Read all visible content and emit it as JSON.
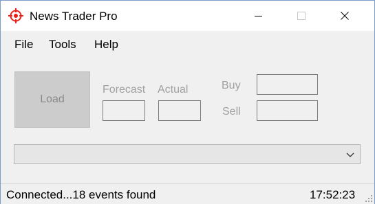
{
  "window": {
    "title": "News Trader Pro",
    "icons": {
      "app": "crosshair-target-icon",
      "minimize": "minimize-icon",
      "maximize": "maximize-icon",
      "close": "close-icon"
    },
    "accent_color": "#e8231c"
  },
  "menu": {
    "items": [
      {
        "label": "File"
      },
      {
        "label": "Tools"
      },
      {
        "label": "Help"
      }
    ]
  },
  "controls": {
    "load_label": "Load",
    "forecast_label": "Forecast",
    "forecast_value": "",
    "actual_label": "Actual",
    "actual_value": "",
    "buy_label": "Buy",
    "buy_value": "",
    "sell_label": "Sell",
    "sell_value": ""
  },
  "events_dropdown": {
    "selected": "",
    "icon": "chevron-down-icon"
  },
  "status": {
    "text": "Connected...18 events found",
    "time": "17:52:23"
  }
}
